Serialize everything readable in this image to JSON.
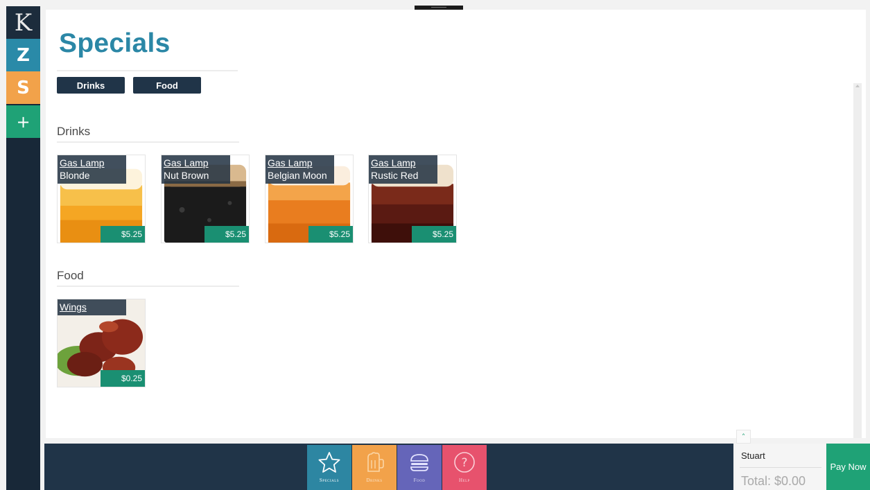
{
  "rail": {
    "items": [
      {
        "label": "K",
        "color": "#1c2c3c"
      },
      {
        "label": "Z",
        "color": "#2a8aa8"
      },
      {
        "label": "S",
        "color": "#f2a24a"
      },
      {
        "label": "+",
        "color": "#1fa276"
      }
    ]
  },
  "page": {
    "title": "Specials",
    "filters": [
      "Drinks",
      "Food"
    ]
  },
  "sections": [
    {
      "title": "Drinks",
      "items": [
        {
          "name_line1": "Gas Lamp",
          "name_line2": "Blonde",
          "price": "$5.25"
        },
        {
          "name_line1": "Gas Lamp",
          "name_line2": "Nut Brown",
          "price": "$5.25"
        },
        {
          "name_line1": "Gas Lamp",
          "name_line2": "Belgian Moon",
          "price": "$5.25"
        },
        {
          "name_line1": "Gas Lamp",
          "name_line2": "Rustic Red",
          "price": "$5.25"
        }
      ]
    },
    {
      "title": "Food",
      "items": [
        {
          "name_line1": "Wings",
          "name_line2": "",
          "price": "$0.25"
        }
      ]
    }
  ],
  "bottom_nav": [
    {
      "label": "Specials",
      "icon": "star-icon",
      "color": "#2d86a2",
      "active": true
    },
    {
      "label": "Drinks",
      "icon": "beer-mug-icon",
      "color": "#f2a24a",
      "active": false
    },
    {
      "label": "Food",
      "icon": "burger-icon",
      "color": "#6565b9",
      "active": false
    },
    {
      "label": "Help",
      "icon": "help-circle-icon",
      "color": "#e7526d",
      "active": false
    }
  ],
  "order": {
    "customer": "Stuart",
    "total": "Total: $0.00",
    "pay_label": "Pay Now",
    "expand_icon": "chevron-up-icon"
  },
  "colors": {
    "accent_teal": "#2b87a6",
    "navy": "#203448",
    "price_green": "#1a8f72",
    "pay_green": "#1fa276"
  }
}
